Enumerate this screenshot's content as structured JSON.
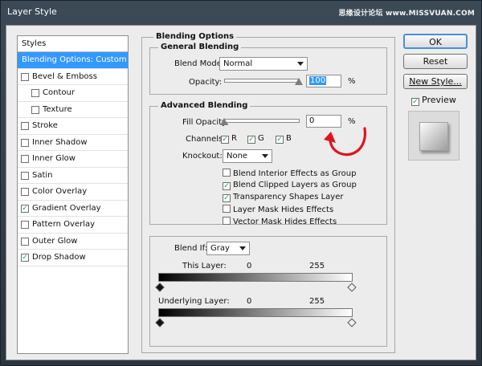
{
  "window": {
    "title": "Layer Style",
    "watermark": "思缘设计论坛 www.MISSVUAN.COM"
  },
  "styles_panel": {
    "header": "Styles",
    "items": [
      {
        "label": "Blending Options: Custom",
        "selected": true,
        "checkbox": false,
        "checked": false,
        "sub": false
      },
      {
        "label": "Bevel & Emboss",
        "checkbox": true,
        "checked": false,
        "sub": false
      },
      {
        "label": "Contour",
        "checkbox": true,
        "checked": false,
        "sub": true
      },
      {
        "label": "Texture",
        "checkbox": true,
        "checked": false,
        "sub": true
      },
      {
        "label": "Stroke",
        "checkbox": true,
        "checked": false,
        "sub": false
      },
      {
        "label": "Inner Shadow",
        "checkbox": true,
        "checked": false,
        "sub": false
      },
      {
        "label": "Inner Glow",
        "checkbox": true,
        "checked": false,
        "sub": false
      },
      {
        "label": "Satin",
        "checkbox": true,
        "checked": false,
        "sub": false
      },
      {
        "label": "Color Overlay",
        "checkbox": true,
        "checked": false,
        "sub": false
      },
      {
        "label": "Gradient Overlay",
        "checkbox": true,
        "checked": true,
        "sub": false
      },
      {
        "label": "Pattern Overlay",
        "checkbox": true,
        "checked": false,
        "sub": false
      },
      {
        "label": "Outer Glow",
        "checkbox": true,
        "checked": false,
        "sub": false
      },
      {
        "label": "Drop Shadow",
        "checkbox": true,
        "checked": true,
        "sub": false
      }
    ]
  },
  "blending": {
    "title": "Blending Options",
    "general": {
      "title": "General Blending",
      "blend_mode_label": "Blend Mode:",
      "blend_mode_value": "Normal",
      "opacity_label": "Opacity:",
      "opacity_value": "100",
      "opacity_unit": "%"
    },
    "advanced": {
      "title": "Advanced Blending",
      "fill_opacity_label": "Fill Opacity:",
      "fill_opacity_value": "0",
      "fill_opacity_unit": "%",
      "channels_label": "Channels:",
      "channels": [
        {
          "label": "R",
          "checked": true
        },
        {
          "label": "G",
          "checked": true
        },
        {
          "label": "B",
          "checked": true
        }
      ],
      "knockout_label": "Knockout:",
      "knockout_value": "None",
      "options": [
        {
          "label": "Blend Interior Effects as Group",
          "checked": false
        },
        {
          "label": "Blend Clipped Layers as Group",
          "checked": true
        },
        {
          "label": "Transparency Shapes Layer",
          "checked": true
        },
        {
          "label": "Layer Mask Hides Effects",
          "checked": false
        },
        {
          "label": "Vector Mask Hides Effects",
          "checked": false
        }
      ]
    },
    "blend_if": {
      "label": "Blend If:",
      "value": "Gray",
      "this_layer_label": "This Layer:",
      "this_layer_min": "0",
      "this_layer_max": "255",
      "underlying_label": "Underlying Layer:",
      "underlying_min": "0",
      "underlying_max": "255"
    }
  },
  "buttons": {
    "ok": "OK",
    "reset": "Reset",
    "new_style": "New Style...",
    "preview_label": "Preview",
    "preview_checked": true
  },
  "colors": {
    "selection": "#3399ff",
    "annotation": "#e0141b"
  }
}
